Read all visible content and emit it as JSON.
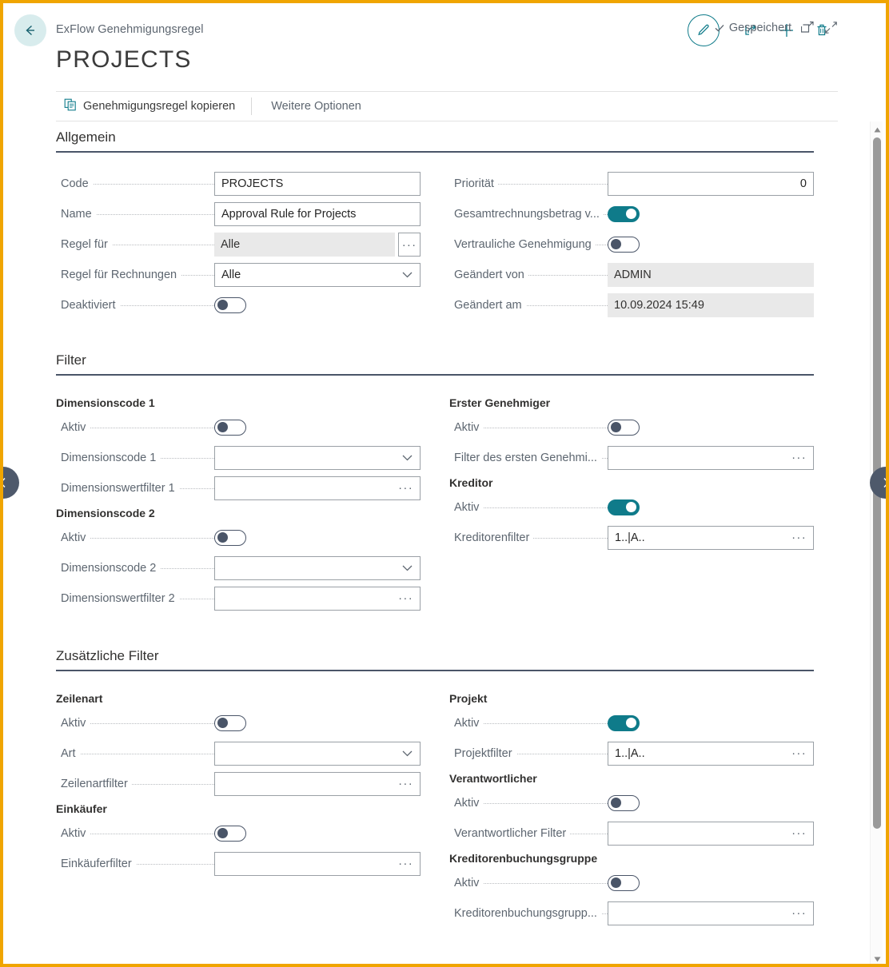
{
  "window": {
    "breadcrumb": "ExFlow Genehmigungsregel",
    "title": "PROJECTS",
    "saved_status": "Gespeichert",
    "accent_teal": "#0f7b8a",
    "border_orange": "#f0a500",
    "toggle_off_color": "#4a5568"
  },
  "top_actions": [
    {
      "name": "edit-icon",
      "label": "Bearbeiten"
    },
    {
      "name": "share-icon",
      "label": "Freigeben"
    },
    {
      "name": "plus-icon",
      "label": "Neu"
    },
    {
      "name": "trash-icon",
      "label": "Löschen"
    }
  ],
  "right_actions": [
    {
      "name": "open-new-window-icon",
      "label": "In neuem Fenster öffnen"
    },
    {
      "name": "collapse-icon",
      "label": "Reduzieren"
    }
  ],
  "commandbar": {
    "copy_rule": "Genehmigungsregel kopieren",
    "more_options": "Weitere Optionen"
  },
  "sections": [
    {
      "title": "Allgemein",
      "left": [
        {
          "kind": "field",
          "label": "Code",
          "value": "PROJECTS",
          "control": "text"
        },
        {
          "kind": "field",
          "label": "Name",
          "value": "Approval Rule for Projects",
          "control": "text"
        },
        {
          "kind": "field",
          "label": "Regel für",
          "value": "Alle",
          "control": "readonly-assist"
        },
        {
          "kind": "field",
          "label": "Regel für Rechnungen",
          "value": "Alle",
          "control": "dropdown"
        },
        {
          "kind": "toggle",
          "label": "Deaktiviert",
          "value": false
        }
      ],
      "right": [
        {
          "kind": "field",
          "label": "Priorität",
          "value": "0",
          "control": "number"
        },
        {
          "kind": "toggle",
          "label": "Gesamtrechnungsbetrag v...",
          "value": true
        },
        {
          "kind": "toggle",
          "label": "Vertrauliche Genehmigung",
          "value": false
        },
        {
          "kind": "field",
          "label": "Geändert von",
          "value": "ADMIN",
          "control": "readonly"
        },
        {
          "kind": "field",
          "label": "Geändert am",
          "value": "10.09.2024 15:49",
          "control": "readonly"
        }
      ]
    },
    {
      "title": "Filter",
      "left": [
        {
          "kind": "group",
          "label": "Dimensionscode 1"
        },
        {
          "kind": "toggle",
          "label": "Aktiv",
          "value": false
        },
        {
          "kind": "field",
          "label": "Dimensionscode 1",
          "value": "",
          "control": "dropdown"
        },
        {
          "kind": "field",
          "label": "Dimensionswertfilter 1",
          "value": "",
          "control": "assist-inline"
        },
        {
          "kind": "group",
          "label": "Dimensionscode 2"
        },
        {
          "kind": "toggle",
          "label": "Aktiv",
          "value": false
        },
        {
          "kind": "field",
          "label": "Dimensionscode 2",
          "value": "",
          "control": "dropdown"
        },
        {
          "kind": "field",
          "label": "Dimensionswertfilter 2",
          "value": "",
          "control": "assist-inline"
        }
      ],
      "right": [
        {
          "kind": "group",
          "label": "Erster Genehmiger"
        },
        {
          "kind": "toggle",
          "label": "Aktiv",
          "value": false
        },
        {
          "kind": "field",
          "label": "Filter des ersten Genehmi...",
          "value": "",
          "control": "assist-inline"
        },
        {
          "kind": "group",
          "label": "Kreditor"
        },
        {
          "kind": "toggle",
          "label": "Aktiv",
          "value": true
        },
        {
          "kind": "field",
          "label": "Kreditorenfilter",
          "value": "1..|A..",
          "control": "assist-inline"
        }
      ]
    },
    {
      "title": "Zusätzliche Filter",
      "left": [
        {
          "kind": "group",
          "label": "Zeilenart"
        },
        {
          "kind": "toggle",
          "label": "Aktiv",
          "value": false
        },
        {
          "kind": "field",
          "label": "Art",
          "value": "",
          "control": "dropdown"
        },
        {
          "kind": "field",
          "label": "Zeilenartfilter",
          "value": "",
          "control": "assist-inline"
        },
        {
          "kind": "group",
          "label": "Einkäufer"
        },
        {
          "kind": "toggle",
          "label": "Aktiv",
          "value": false
        },
        {
          "kind": "field",
          "label": "Einkäuferfilter",
          "value": "",
          "control": "assist-inline"
        }
      ],
      "right": [
        {
          "kind": "group",
          "label": "Projekt"
        },
        {
          "kind": "toggle",
          "label": "Aktiv",
          "value": true
        },
        {
          "kind": "field",
          "label": "Projektfilter",
          "value": "1..|A..",
          "control": "assist-inline"
        },
        {
          "kind": "group",
          "label": "Verantwortlicher"
        },
        {
          "kind": "toggle",
          "label": "Aktiv",
          "value": false
        },
        {
          "kind": "field",
          "label": "Verantwortlicher Filter",
          "value": "",
          "control": "assist-inline"
        },
        {
          "kind": "group",
          "label": "Kreditorenbuchungsgruppe"
        },
        {
          "kind": "toggle",
          "label": "Aktiv",
          "value": false
        },
        {
          "kind": "field",
          "label": "Kreditorenbuchungsgrupp...",
          "value": "",
          "control": "assist-inline"
        }
      ]
    }
  ],
  "sidenav": {
    "prev": "Vorheriger",
    "next": "Nächster"
  }
}
